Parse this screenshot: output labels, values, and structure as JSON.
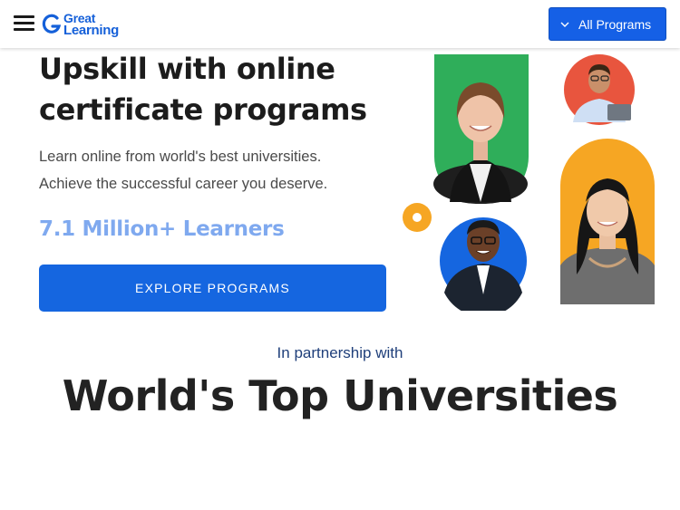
{
  "header": {
    "logo_line1": "Great",
    "logo_line2": "Learning",
    "programs_button": "All Programs"
  },
  "hero": {
    "title_line1": "Upskill with online",
    "title_line2": "certificate programs",
    "subtitle_line1": "Learn online from world's best universities.",
    "subtitle_line2": "Achieve the successful career you deserve.",
    "learners": "7.1 Million+ Learners",
    "cta": "EXPLORE PROGRAMS"
  },
  "partners": {
    "intro": "In partnership with",
    "heading": "World's Top Universities"
  },
  "colors": {
    "brand_blue": "#1566e0",
    "accent_green": "#2fae5a",
    "accent_orange": "#f6a623",
    "accent_red": "#e8553e"
  },
  "icons": [
    "menu-icon",
    "great-learning-logo",
    "chevron-down-icon"
  ]
}
